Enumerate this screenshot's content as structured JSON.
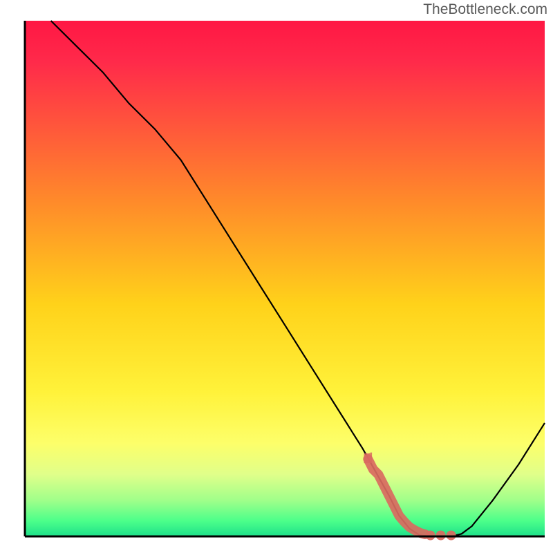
{
  "watermark": "TheBottleneck.com",
  "chart_data": {
    "type": "line",
    "title": "",
    "xlabel": "",
    "ylabel": "",
    "xlim": [
      0,
      100
    ],
    "ylim": [
      0,
      100
    ],
    "series": [
      {
        "name": "curve",
        "x": [
          5,
          10,
          15,
          20,
          25,
          30,
          35,
          40,
          45,
          50,
          55,
          60,
          65,
          70,
          72,
          74,
          76,
          78,
          80,
          82,
          84,
          86,
          90,
          95,
          100
        ],
        "y": [
          100,
          95,
          90,
          84,
          79,
          73,
          65,
          57,
          49,
          41,
          33,
          25,
          17,
          8,
          4,
          1.5,
          0.2,
          0,
          0,
          0,
          0.5,
          2,
          7,
          14,
          22
        ]
      },
      {
        "name": "highlight",
        "x": [
          66,
          67,
          68,
          69,
          70,
          71,
          72,
          73,
          74,
          75,
          76,
          77,
          78,
          80,
          82
        ],
        "y": [
          15,
          13,
          12,
          10,
          8,
          6,
          4,
          2.8,
          1.8,
          1.2,
          0.7,
          0.4,
          0.2,
          0.2,
          0.2
        ]
      }
    ],
    "gradient_stops": [
      {
        "offset": 0.0,
        "color": "#ff1744"
      },
      {
        "offset": 0.08,
        "color": "#ff2a4a"
      },
      {
        "offset": 0.35,
        "color": "#ff8a2a"
      },
      {
        "offset": 0.55,
        "color": "#ffd21a"
      },
      {
        "offset": 0.72,
        "color": "#fff23a"
      },
      {
        "offset": 0.82,
        "color": "#fdff6a"
      },
      {
        "offset": 0.88,
        "color": "#e0ff8a"
      },
      {
        "offset": 0.93,
        "color": "#a0ff8a"
      },
      {
        "offset": 0.97,
        "color": "#4cff8a"
      },
      {
        "offset": 1.0,
        "color": "#1de08a"
      }
    ],
    "highlight_color": "#d96a5f",
    "curve_color": "#000000"
  }
}
